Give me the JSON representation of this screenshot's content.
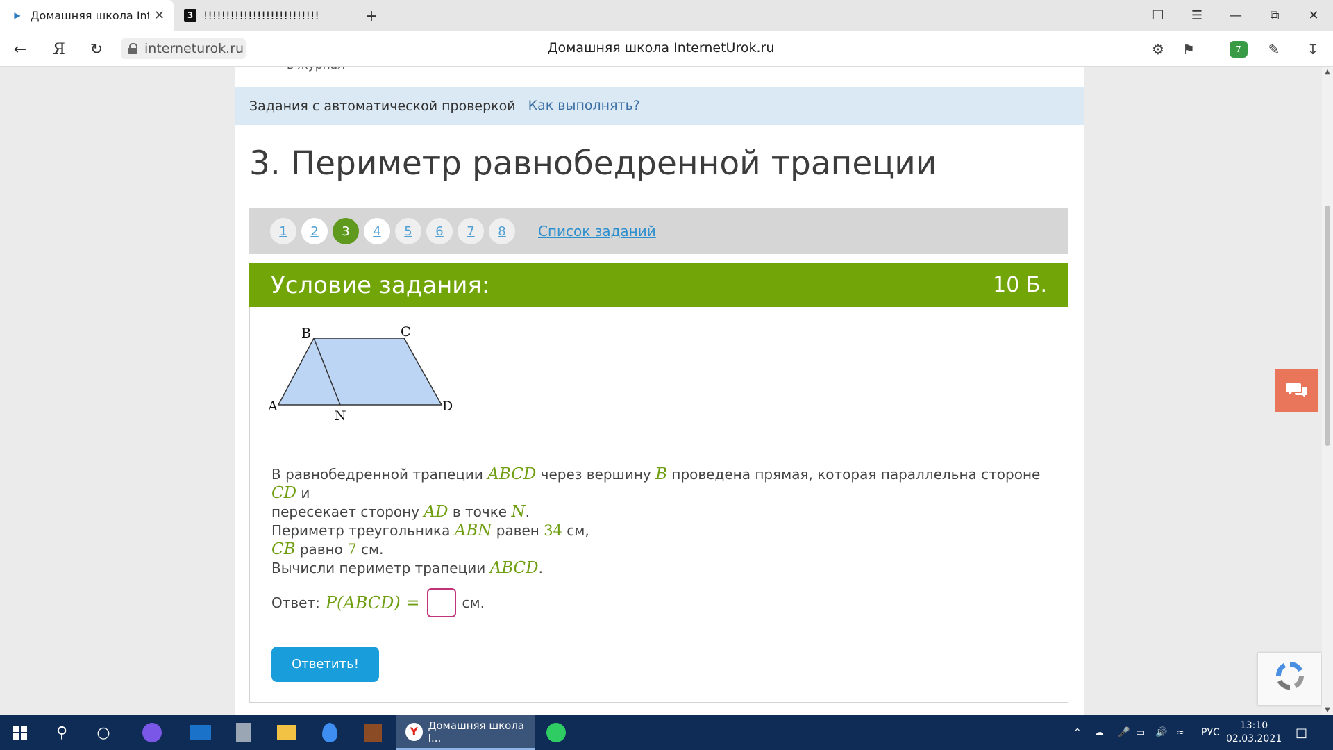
{
  "browser": {
    "tabs": [
      {
        "title": "Домашняя школа InternetUrok.ru",
        "active": true
      },
      {
        "title": "!!!!!!!!!!!!!!!!!!!!!!!!!!!!!!!!!!!!!!!!",
        "active": false
      }
    ],
    "url": "interneturok.ru",
    "page_title": "Домашняя школа InternetUrok.ru",
    "shield_badge": "7"
  },
  "page": {
    "cut_text": "в журнал",
    "auto_check_label": "Задания с автоматической проверкой",
    "how_link": "Как выполнять?",
    "heading": "3. Периметр равнобедренной трапеции",
    "pager": {
      "pages": [
        "1",
        "2",
        "3",
        "4",
        "5",
        "6",
        "7",
        "8"
      ],
      "current": "3",
      "task_list": "Список заданий"
    },
    "condition": {
      "label": "Условие задания:",
      "points": "10 Б."
    },
    "figure": {
      "vertex_labels": [
        "A",
        "B",
        "C",
        "D",
        "N"
      ]
    },
    "problem": {
      "l1a": "В равнобедренной трапеции",
      "m1": "ABCD",
      "l1b": "через вершину",
      "m2": "B",
      "l1c": "проведена прямая, которая параллельна стороне",
      "m3": "CD",
      "l1d": "и",
      "l2a": "пересекает сторону",
      "m4": "AD",
      "l2b": "в точке",
      "m5": "N",
      "l2c": ".",
      "l3a": "Периметр треугольника",
      "m6": "ABN",
      "l3b": "равен",
      "n1": "34",
      "l3c": "см,",
      "m7": "CB",
      "l4a": "равно",
      "n2": "7",
      "l4b": "см.",
      "l5a": "Вычисли периметр трапеции",
      "m8": "ABCD",
      "l5b": "."
    },
    "answer": {
      "label": "Ответ:",
      "formula": "P(ABCD) =",
      "value": "",
      "unit": "см."
    },
    "submit_label": "Ответить!"
  },
  "taskbar": {
    "app_label": "Домашняя школа I...",
    "lang": "РУС",
    "time": "13:10",
    "date": "02.03.2021"
  },
  "colors": {
    "green_header": "#72a608",
    "math_green": "#6f9e10",
    "submit_blue": "#1a9ddb",
    "strip_blue": "#dbe9f4"
  }
}
